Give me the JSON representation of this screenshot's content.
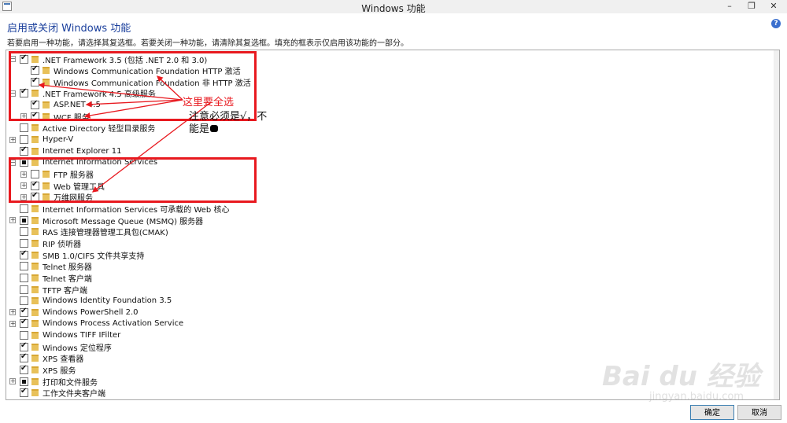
{
  "window": {
    "title": "Windows 功能",
    "minimize": "–",
    "maximize": "❐",
    "close": "✕"
  },
  "header": {
    "heading": "启用或关闭 Windows 功能",
    "instructions": "若要启用一种功能，请选择其复选框。若要关闭一种功能，请清除其复选框。填充的框表示仅启用该功能的一部分。",
    "help": "?"
  },
  "tree": [
    {
      "label": ".NET Framework 3.5 (包括 .NET 2.0 和 3.0)",
      "state": "checked",
      "expand": "−",
      "level": 0
    },
    {
      "label": "Windows Communication Foundation HTTP 激活",
      "state": "checked",
      "expand": "",
      "level": 1
    },
    {
      "label": "Windows Communication Foundation 非 HTTP 激活",
      "state": "checked",
      "expand": "",
      "level": 1
    },
    {
      "label": ".NET Framework 4.5 高级服务",
      "state": "checked",
      "expand": "−",
      "level": 0
    },
    {
      "label": "ASP.NET 4.5",
      "state": "checked",
      "expand": "",
      "level": 1
    },
    {
      "label": "WCF 服务",
      "state": "checked",
      "expand": "+",
      "level": 1
    },
    {
      "label": "Active Directory 轻型目录服务",
      "state": "unchecked",
      "expand": "",
      "level": 0
    },
    {
      "label": "Hyper-V",
      "state": "unchecked",
      "expand": "+",
      "level": 0
    },
    {
      "label": "Internet Explorer 11",
      "state": "checked",
      "expand": "",
      "level": 0
    },
    {
      "label": "Internet Information Services",
      "state": "partial",
      "expand": "−",
      "level": 0
    },
    {
      "label": "FTP 服务器",
      "state": "unchecked",
      "expand": "+",
      "level": 1
    },
    {
      "label": "Web 管理工具",
      "state": "checked",
      "expand": "+",
      "level": 1
    },
    {
      "label": "万维网服务",
      "state": "checked",
      "expand": "+",
      "level": 1
    },
    {
      "label": "Internet Information Services 可承载的 Web 核心",
      "state": "unchecked",
      "expand": "",
      "level": 0
    },
    {
      "label": "Microsoft Message Queue (MSMQ) 服务器",
      "state": "partial",
      "expand": "+",
      "level": 0
    },
    {
      "label": "RAS 连接管理器管理工具包(CMAK)",
      "state": "unchecked",
      "expand": "",
      "level": 0
    },
    {
      "label": "RIP 侦听器",
      "state": "unchecked",
      "expand": "",
      "level": 0
    },
    {
      "label": "SMB 1.0/CIFS 文件共享支持",
      "state": "checked",
      "expand": "",
      "level": 0
    },
    {
      "label": "Telnet 服务器",
      "state": "unchecked",
      "expand": "",
      "level": 0
    },
    {
      "label": "Telnet 客户端",
      "state": "unchecked",
      "expand": "",
      "level": 0
    },
    {
      "label": "TFTP 客户端",
      "state": "unchecked",
      "expand": "",
      "level": 0
    },
    {
      "label": "Windows Identity Foundation 3.5",
      "state": "unchecked",
      "expand": "",
      "level": 0
    },
    {
      "label": "Windows PowerShell 2.0",
      "state": "checked",
      "expand": "+",
      "level": 0
    },
    {
      "label": "Windows Process Activation Service",
      "state": "checked",
      "expand": "+",
      "level": 0
    },
    {
      "label": "Windows TIFF IFilter",
      "state": "unchecked",
      "expand": "",
      "level": 0
    },
    {
      "label": "Windows 定位程序",
      "state": "checked",
      "expand": "",
      "level": 0
    },
    {
      "label": "XPS 查看器",
      "state": "checked",
      "expand": "",
      "level": 0
    },
    {
      "label": "XPS 服务",
      "state": "checked",
      "expand": "",
      "level": 0
    },
    {
      "label": "打印和文件服务",
      "state": "partial",
      "expand": "+",
      "level": 0
    },
    {
      "label": "工作文件夹客户端",
      "state": "checked",
      "expand": "",
      "level": 0
    }
  ],
  "annotations": {
    "select_all": "这里要全选",
    "note_line1": "注意必须是√，不",
    "note_line2": "能是"
  },
  "watermark": {
    "brand": "Bai du 经验",
    "url": "jingyan.baidu.com"
  },
  "buttons": {
    "ok": "确定",
    "cancel": "取消"
  },
  "colors": {
    "accent": "#1a3f9c",
    "annotation_red": "#e8191f"
  }
}
